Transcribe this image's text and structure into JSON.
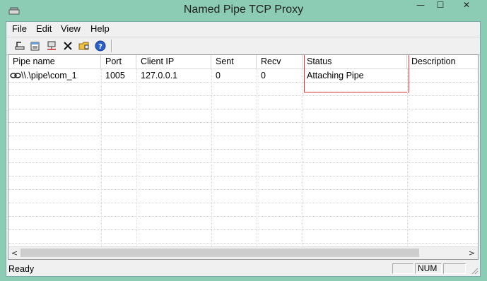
{
  "window": {
    "title": "Named Pipe TCP Proxy",
    "minimize_glyph": "—",
    "maximize_glyph": "☐",
    "close_glyph": "✕"
  },
  "menu": {
    "items": [
      "File",
      "Edit",
      "View",
      "Help"
    ]
  },
  "toolbar": {
    "buttons": [
      {
        "icon": "add-pipe-icon"
      },
      {
        "icon": "properties-icon"
      },
      {
        "icon": "network-icon"
      },
      {
        "icon": "delete-icon"
      },
      {
        "icon": "folder-settings-icon"
      },
      {
        "icon": "help-icon"
      }
    ]
  },
  "list": {
    "columns": [
      "Pipe name",
      "Port",
      "Client IP",
      "Sent",
      "Recv",
      "Status",
      "Description"
    ],
    "rows": [
      {
        "pipe_name": "\\\\.\\pipe\\com_1",
        "port": "1005",
        "client_ip": "127.0.0.1",
        "sent": "0",
        "recv": "0",
        "status": "Attaching Pipe",
        "description": ""
      }
    ],
    "highlight_color": "#d9343a"
  },
  "scroll": {
    "left_arrow": "<",
    "right_arrow": ">"
  },
  "statusbar": {
    "text": "Ready",
    "panes": [
      "",
      "NUM",
      ""
    ]
  },
  "colors": {
    "frame": "#8ccbb4",
    "chrome": "#f0f0f0"
  }
}
